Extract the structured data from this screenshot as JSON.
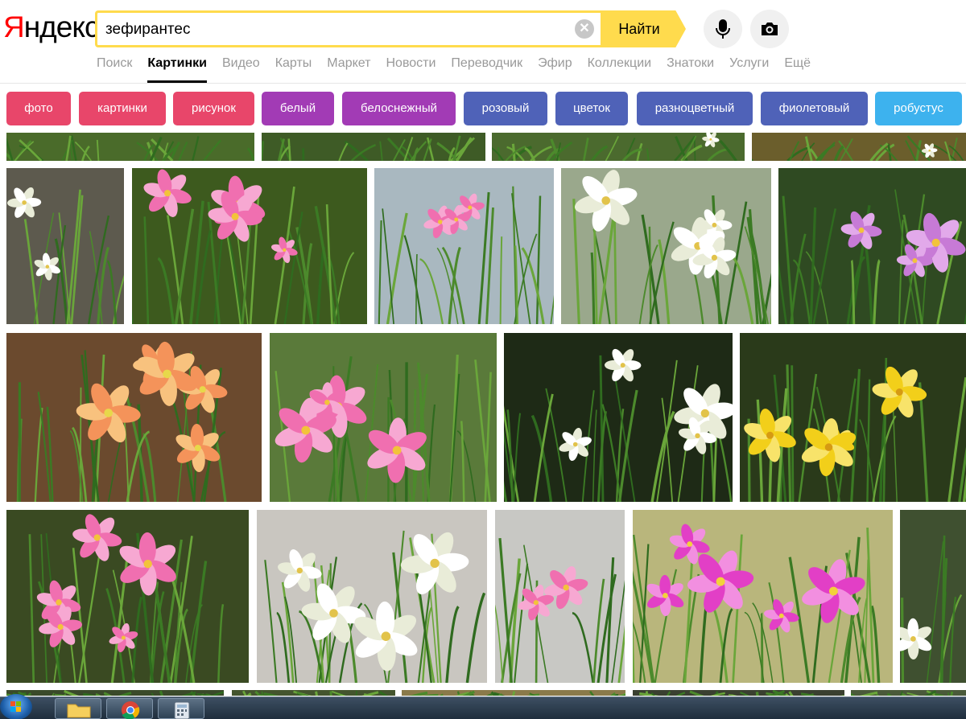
{
  "header": {
    "logo": {
      "first_letter": "Я",
      "rest": "ндекс"
    },
    "search": {
      "query": "зефирантес",
      "submit_label": "Найти"
    },
    "nav": [
      {
        "label": "Поиск",
        "active": false
      },
      {
        "label": "Картинки",
        "active": true
      },
      {
        "label": "Видео",
        "active": false
      },
      {
        "label": "Карты",
        "active": false
      },
      {
        "label": "Маркет",
        "active": false
      },
      {
        "label": "Новости",
        "active": false
      },
      {
        "label": "Переводчик",
        "active": false
      },
      {
        "label": "Эфир",
        "active": false
      },
      {
        "label": "Коллекции",
        "active": false
      },
      {
        "label": "Знатоки",
        "active": false
      },
      {
        "label": "Услуги",
        "active": false
      },
      {
        "label": "Ещё",
        "active": false
      }
    ]
  },
  "tags": [
    {
      "label": "фото",
      "color": "#e8466a"
    },
    {
      "label": "картинки",
      "color": "#e8466a"
    },
    {
      "label": "рисунок",
      "color": "#e8466a"
    },
    {
      "label": "белый",
      "color": "#a23bb5"
    },
    {
      "label": "белоснежный",
      "color": "#a23bb5"
    },
    {
      "label": "розовый",
      "color": "#4f62b8"
    },
    {
      "label": "цветок",
      "color": "#4f62b8"
    },
    {
      "label": "разноцветный",
      "color": "#4f62b8"
    },
    {
      "label": "фиолетовый",
      "color": "#4f62b8"
    },
    {
      "label": "робустус",
      "color": "#3db2ee"
    }
  ],
  "results": [
    {
      "flower": "green-leaves",
      "bg": "#4a6b2a"
    },
    {
      "flower": "green-leaves",
      "bg": "#3e5b26"
    },
    {
      "flower": "white",
      "bg": "#4b6a2e"
    },
    {
      "flower": "white",
      "bg": "#6b5e2c"
    },
    {
      "flower": "white",
      "bg": "#5d5a4e"
    },
    {
      "flower": "pink",
      "bg": "#3d5a1e"
    },
    {
      "flower": "pink",
      "bg": "#a9b8c0"
    },
    {
      "flower": "white",
      "bg": "#9aa88c"
    },
    {
      "flower": "purple",
      "bg": "#2f4a22"
    },
    {
      "flower": "peach",
      "bg": "#6b4a2e"
    },
    {
      "flower": "pink",
      "bg": "#5a7a3a"
    },
    {
      "flower": "white",
      "bg": "#1e2a16"
    },
    {
      "flower": "yellow",
      "bg": "#2a3a1a"
    },
    {
      "flower": "pink",
      "bg": "#3a4a22"
    },
    {
      "flower": "white",
      "bg": "#c9c6c0"
    },
    {
      "flower": "pink",
      "bg": "#c8c8c4"
    },
    {
      "flower": "magenta",
      "bg": "#b9b67c"
    },
    {
      "flower": "white",
      "bg": "#3f5030"
    },
    {
      "flower": "green-leaves",
      "bg": "#3a4a2a"
    },
    {
      "flower": "green-leaves",
      "bg": "#44552e"
    },
    {
      "flower": "green-leaves",
      "bg": "#8a7a4a"
    },
    {
      "flower": "green-leaves",
      "bg": "#3a4030"
    },
    {
      "flower": "green-leaves",
      "bg": "#4a5a3a"
    }
  ],
  "taskbar": {
    "apps": [
      {
        "icon": "folder-icon"
      },
      {
        "icon": "chrome-icon"
      },
      {
        "icon": "calculator-icon"
      }
    ]
  }
}
